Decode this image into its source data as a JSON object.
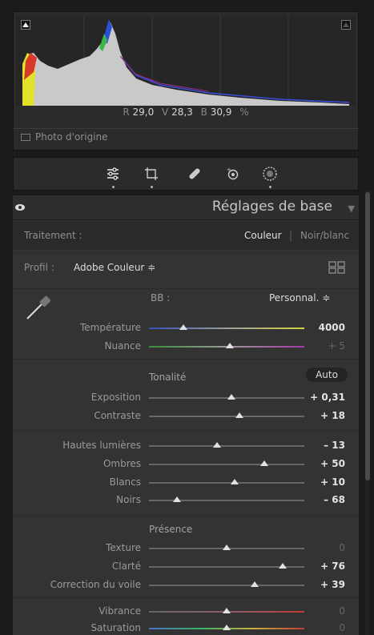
{
  "histogram": {
    "readout": {
      "r_label": "R",
      "r_value": "29,0",
      "v_label": "V",
      "v_value": "28,3",
      "b_label": "B",
      "b_value": "30,9",
      "unit": "%"
    },
    "original_photo_label": "Photo d'origine"
  },
  "tools": [
    {
      "name": "edit-sliders-icon"
    },
    {
      "name": "crop-icon"
    },
    {
      "name": "healing-icon"
    },
    {
      "name": "redeye-icon"
    },
    {
      "name": "masking-icon"
    }
  ],
  "panel": {
    "title": "Réglages de base",
    "collapse_icon": "▼"
  },
  "treatment": {
    "label": "Traitement :",
    "color": "Couleur",
    "separator": "|",
    "bw": "Noir/blanc"
  },
  "profile": {
    "label": "Profil :",
    "value": "Adobe Couleur ≑"
  },
  "wb": {
    "label": "BB :",
    "value": "Personnal. ≑"
  },
  "sliders": {
    "temperature": {
      "label": "Température",
      "value": "4000",
      "pos": 0.22
    },
    "tint": {
      "label": "Nuance",
      "value": "+ 5",
      "pos": 0.52
    },
    "tone_title": "Tonalité",
    "auto": "Auto",
    "exposure": {
      "label": "Exposition",
      "value": "+ 0,31",
      "pos": 0.53
    },
    "contrast": {
      "label": "Contraste",
      "value": "+ 18",
      "pos": 0.58
    },
    "highlights": {
      "label": "Hautes lumières",
      "value": "– 13",
      "pos": 0.44
    },
    "shadows": {
      "label": "Ombres",
      "value": "+ 50",
      "pos": 0.74
    },
    "whites": {
      "label": "Blancs",
      "value": "+ 10",
      "pos": 0.55
    },
    "blacks": {
      "label": "Noirs",
      "value": "– 68",
      "pos": 0.18
    },
    "presence_title": "Présence",
    "texture": {
      "label": "Texture",
      "value": "0",
      "pos": 0.5
    },
    "clarity": {
      "label": "Clarté",
      "value": "+ 76",
      "pos": 0.86
    },
    "dehaze": {
      "label": "Correction du voile",
      "value": "+ 39",
      "pos": 0.68
    },
    "vibrance": {
      "label": "Vibrance",
      "value": "0",
      "pos": 0.5
    },
    "saturation": {
      "label": "Saturation",
      "value": "0",
      "pos": 0.5
    }
  },
  "colors": {
    "panel_bg": "#333333",
    "header_bg": "#2e2e2e",
    "accent_text": "#e4e4e4"
  }
}
